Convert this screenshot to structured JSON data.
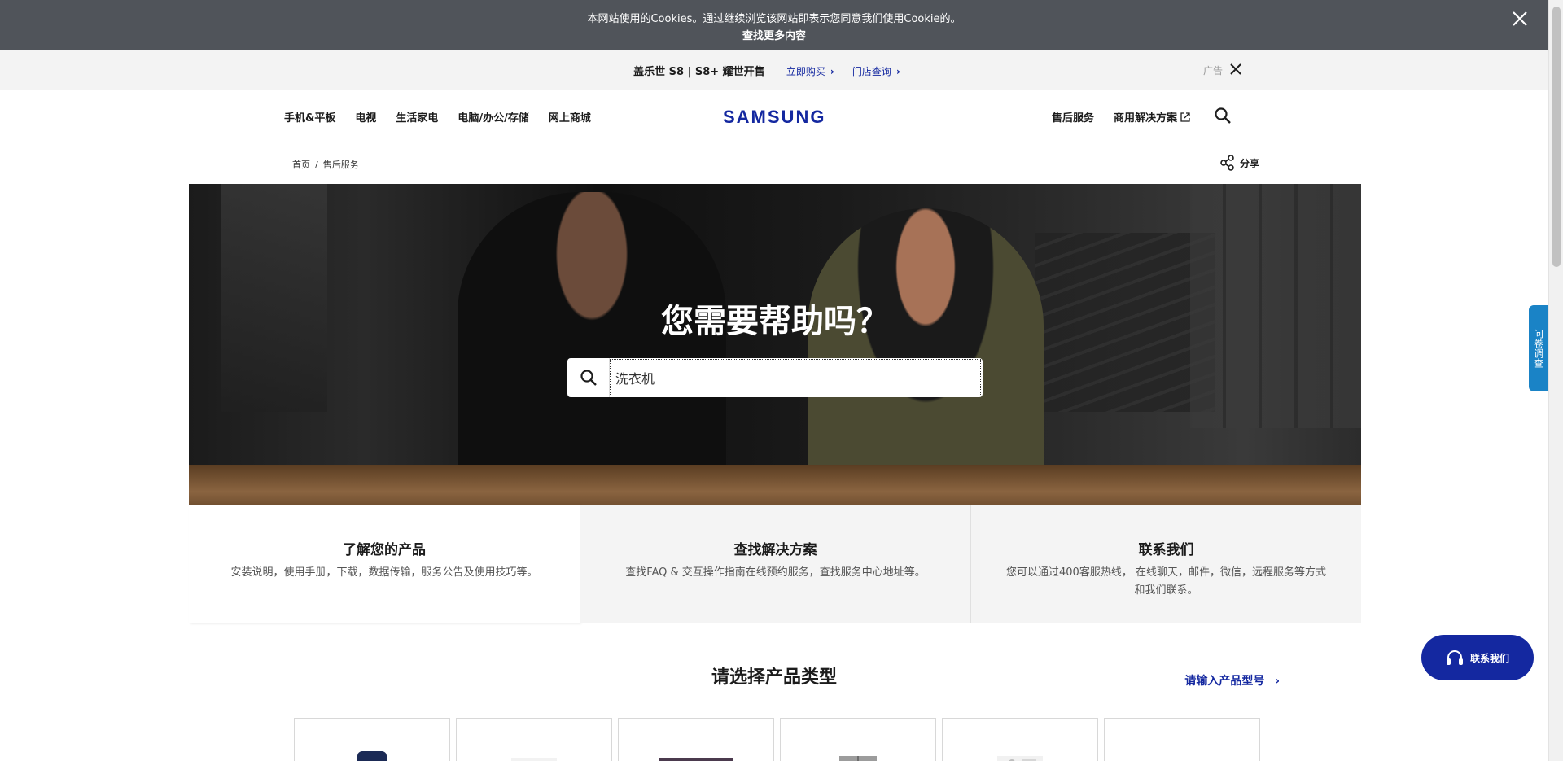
{
  "cookie": {
    "message": "本网站使用的Cookies。通过继续浏览该网站即表示您同意我们使用Cookie的。",
    "learn_more": "查找更多内容",
    "close_icon": "close-icon"
  },
  "promo": {
    "headline": "盖乐世 S8 | S8+ 耀世开售",
    "buy_now": "立即购买",
    "store_lookup": "门店查询",
    "ad_label": "广告"
  },
  "nav": {
    "left_items": [
      "手机&平板",
      "电视",
      "生活家电",
      "电脑/办公/存储",
      "网上商城"
    ],
    "logo": "SAMSUNG",
    "right_items": {
      "service": "售后服务",
      "business": "商用解决方案"
    }
  },
  "breadcrumb": {
    "home": "首页",
    "separator": "/",
    "current": "售后服务"
  },
  "share": {
    "label": "分享"
  },
  "hero": {
    "title": "您需要帮助吗？",
    "search_value": "洗衣机"
  },
  "tabs": [
    {
      "title": "了解您的产品",
      "desc": "安装说明，使用手册，下载，数据传输，服务公告及使用技巧等。"
    },
    {
      "title": "查找解决方案",
      "desc": "查找FAQ & 交互操作指南在线预约服务，查找服务中心地址等。"
    },
    {
      "title": "联系我们",
      "desc": "您可以通过400客服热线， 在线聊天，邮件，微信，远程服务等方式和我们联系。"
    }
  ],
  "product_section": {
    "title": "请选择产品类型",
    "model_link": "请输入产品型号"
  },
  "floating": {
    "survey": "问卷调查",
    "contact": "联系我们"
  },
  "colors": {
    "brand": "#1428a0",
    "cookie_bg": "#50545a",
    "survey": "#1a83c6"
  }
}
